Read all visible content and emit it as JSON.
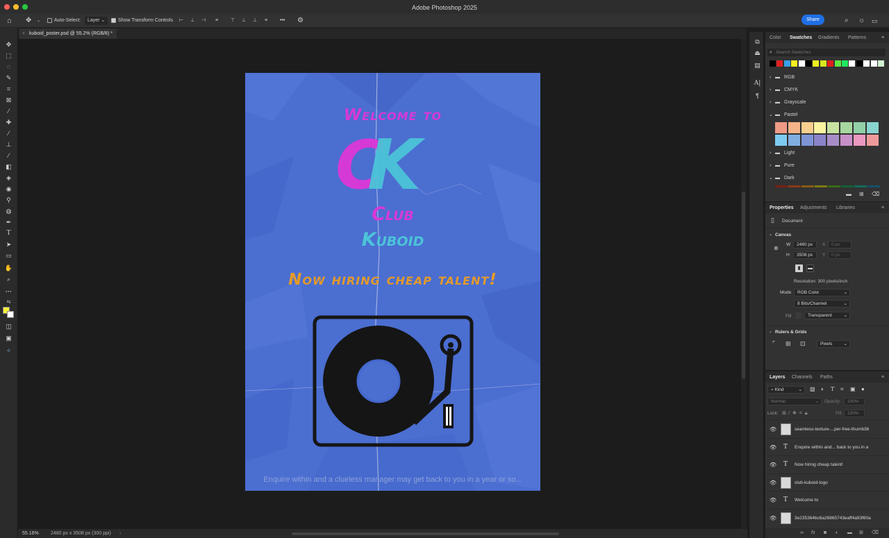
{
  "app": {
    "title": "Adobe Photoshop 2025",
    "share_label": "Share"
  },
  "options_bar": {
    "auto_select_label": "Auto-Select:",
    "auto_select_value": "Layer",
    "transform_label": "Show Transform Controls",
    "more_label": "•••"
  },
  "document": {
    "tab_label": "kuboid_poster.psd @ 55.2% (RGB/8) *"
  },
  "poster": {
    "welcome": "Welcome to",
    "logo_c": "C",
    "logo_k": "K",
    "club": "Club",
    "kuboid": "Kuboid",
    "hiring": "Now hiring cheap talent!",
    "footer": "Enquire within and a clueless manager may get back to you in a year or so...",
    "colors": {
      "background": "#4b6ed1",
      "magenta": "#d63ad6",
      "cyan": "#4cc4d8",
      "orange": "#e39a2a"
    }
  },
  "status": {
    "zoom": "55.16%",
    "doc_info": "2480 px x 3508 px (300 ppi)"
  },
  "swatches_panel": {
    "tabs": [
      "Color",
      "Swatches",
      "Gradients",
      "Patterns"
    ],
    "search_placeholder": "Search Swatches",
    "recent_colors": [
      "#000000",
      "#e02020",
      "#3aa0e8",
      "#f4f020",
      "#ffffff",
      "#000000",
      "#eef020",
      "#d8e820",
      "#e02020",
      "#60e840",
      "#20e860",
      "#ffffff",
      "#000000",
      "#ffffff",
      "#ffffff",
      "#d0f0d0"
    ],
    "groups": [
      "RGB",
      "CMYK",
      "Grayscale",
      "Pastel",
      "Light",
      "Pure",
      "Dark"
    ],
    "pastel_colors": [
      "#ee9b86",
      "#f4b48a",
      "#f7cf8e",
      "#fbf5a0",
      "#c8e2a0",
      "#a8d8a0",
      "#92d0a8",
      "#8ad4cf",
      "#7ecbef",
      "#80aee0",
      "#7f95d6",
      "#8a84c8",
      "#a88ec8",
      "#c890c8",
      "#ec98c0",
      "#ef9a9a"
    ],
    "dark_colors": [
      "#7a1e14",
      "#8a3a14",
      "#8a5a14",
      "#7a7a14",
      "#3a6a14",
      "#14603a",
      "#146a5a",
      "#14506a"
    ]
  },
  "properties_panel": {
    "tabs": [
      "Properties",
      "Adjustments",
      "Libraries"
    ],
    "doc_label": "Document",
    "canvas_label": "Canvas",
    "w_label": "W",
    "w_value": "2480 px",
    "h_label": "H",
    "h_value": "3508 px",
    "x_label": "X",
    "x_value": "0 px",
    "y_label": "Y",
    "y_value": "0 px",
    "resolution": "Resolution: 300 pixels/inch",
    "mode_label": "Mode",
    "mode_value": "RGB Color",
    "bits_value": "8 Bits/Channel",
    "fill_label": "Fill",
    "fill_value": "Transparent",
    "rulers_label": "Rulers & Grids",
    "units_value": "Pixels"
  },
  "layers_panel": {
    "tabs": [
      "Layers",
      "Channels",
      "Paths"
    ],
    "kind_label": "Kind",
    "blend_mode": "Normal",
    "opacity_label": "Opacity:",
    "opacity_value": "100%",
    "lock_label": "Lock:",
    "fill_label": "Fill:",
    "fill_value": "100%",
    "layers": [
      {
        "name": "seamless-texture-...per-free-thumb36",
        "kind": "image"
      },
      {
        "name": "Enquire within and... back to you in a",
        "kind": "text"
      },
      {
        "name": "Now hiring cheap talent!",
        "kind": "text"
      },
      {
        "name": "club-kuboid-logo",
        "kind": "image"
      },
      {
        "name": "Welcome to",
        "kind": "text"
      },
      {
        "name": "3e235364bc6a26865743eaff4a93f60a",
        "kind": "image"
      }
    ]
  }
}
